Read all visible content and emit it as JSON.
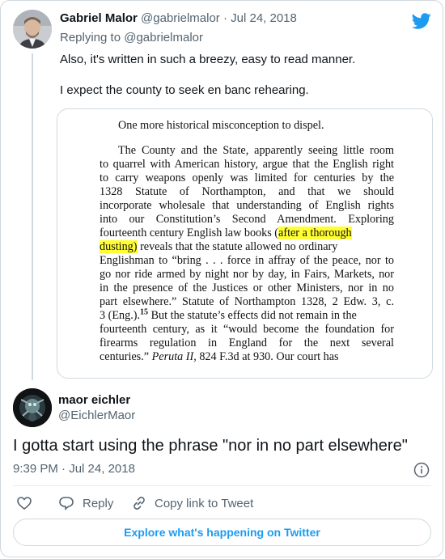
{
  "reply": {
    "name": "Gabriel Malor",
    "handle": "@gabrielmalor",
    "separator": "·",
    "date": "Jul 24, 2018",
    "replying_prefix": "Replying to",
    "replying_to": "@gabrielmalor",
    "text_line1": "Also, it's written in such a breezy, easy to read manner.",
    "text_line2": "I expect the county to seek en banc rehearing."
  },
  "document": {
    "heading": "One more historical misconception to dispel.",
    "line1": "The County and the State, apparently seeing little room",
    "line2": "to quarrel with American history, argue that the English right",
    "line3": "to carry weapons openly was limited for centuries by the",
    "line4": "1328 Statute of Northampton, and that we should",
    "line5": "incorporate wholesale that understanding of English rights",
    "line6": "into our Constitution’s Second Amendment. Exploring",
    "line7_a": "fourteenth century English law books (",
    "line7_hl": "after a thorough",
    "line8_hl": "dusting)",
    "line8_b": " reveals that the statute allowed no ordinary",
    "line9": "Englishman to “bring . . . force in affray of the peace, nor to",
    "line10": "go nor ride armed by night nor by day, in Fairs, Markets, nor",
    "line11": "in the presence of the Justices or other Ministers, nor in no",
    "line12": "part elsewhere.” Statute of Northampton 1328, 2 Edw. 3, c.",
    "line13_a": "3 (Eng.).",
    "line13_fn": "15",
    "line13_b": " But the statute’s effects did not remain in the",
    "line14": "fourteenth century, as it “would become the foundation for",
    "line15": "firearms regulation in England for the next several",
    "line16_a": "centuries.” ",
    "line16_it": "Peruta II",
    "line16_b": ", 824 F.3d at 930. Our court has"
  },
  "tweet": {
    "name": "maor eichler",
    "handle": "@EichlerMaor",
    "text": "I gotta start using the phrase \"nor in no part elsewhere\"",
    "time": "9:39 PM",
    "separator": "·",
    "date": "Jul 24, 2018"
  },
  "actions": {
    "reply_label": "Reply",
    "copy_label": "Copy link to Tweet"
  },
  "explore_label": "Explore what's happening on Twitter",
  "colors": {
    "accent": "#1d9bf0",
    "like_icon": "#536471",
    "highlight": "#ffff33"
  }
}
